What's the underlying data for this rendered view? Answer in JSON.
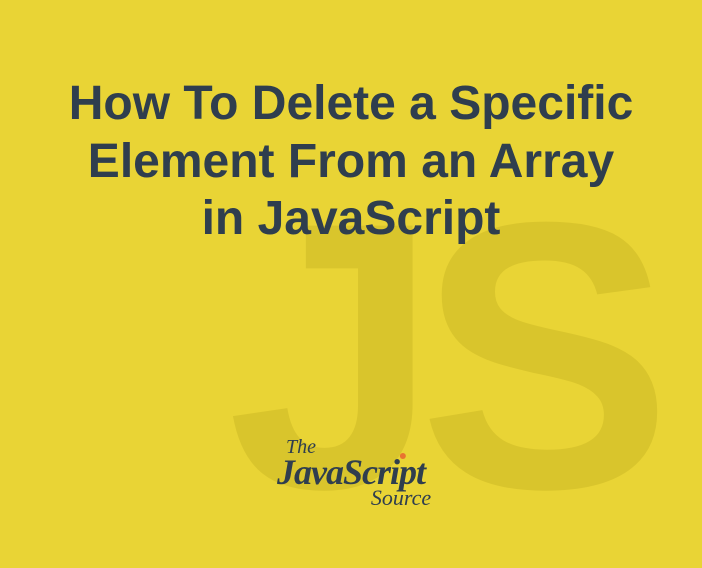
{
  "bg_text": "JS",
  "title": "How To Delete a Specific Element From an Array in JavaScript",
  "logo": {
    "the": "The",
    "java": "Java",
    "script": "Script",
    "source": "Source"
  }
}
